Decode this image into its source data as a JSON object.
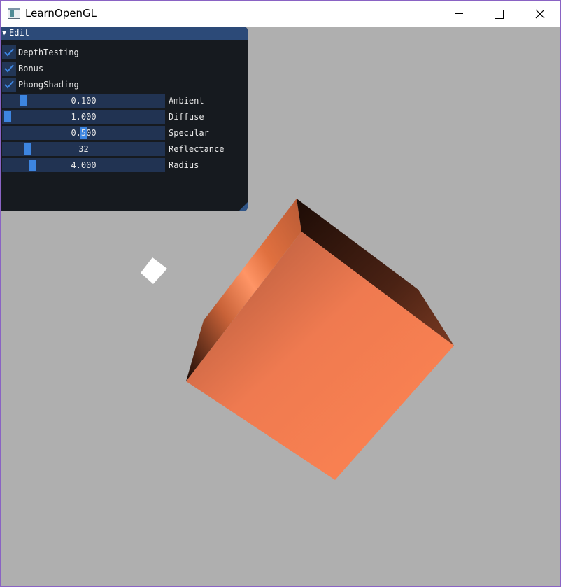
{
  "window": {
    "title": "LearnOpenGL",
    "icon": "app-window-icon",
    "controls": [
      "minimize-icon",
      "maximize-icon",
      "close-icon"
    ]
  },
  "panel": {
    "title": "Edit",
    "collapse_icon": "triangle-down-icon",
    "checkboxes": [
      {
        "label": "DepthTesting",
        "checked": true
      },
      {
        "label": "Bonus",
        "checked": true
      },
      {
        "label": "PhongShading",
        "checked": true
      }
    ],
    "sliders": [
      {
        "label": "Ambient",
        "value": "0.100",
        "fraction": 0.1
      },
      {
        "label": "Diffuse",
        "value": "1.000",
        "fraction": 0.0
      },
      {
        "label": "Specular",
        "value": "0.500",
        "fraction": 0.5
      },
      {
        "label": "Reflectance",
        "value": "32",
        "fraction": 0.13
      },
      {
        "label": "Radius",
        "value": "4.000",
        "fraction": 0.16
      }
    ]
  },
  "scene": {
    "background_color": "#afafaf",
    "cube_color": "#ff8052",
    "light_color": "#ffffff"
  }
}
